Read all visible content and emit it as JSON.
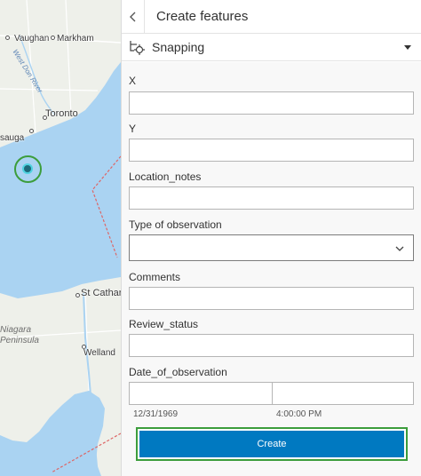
{
  "map": {
    "labels": {
      "vaughan": "Vaughan",
      "markham": "Markham",
      "west_don_river": "West Don River",
      "toronto": "Toronto",
      "mississauga": "sauga",
      "st_catharines": "St Cathari",
      "niagara_peninsula": "Niagara\nPeninsula",
      "welland": "Welland"
    },
    "icons": {
      "location_marker": "location-marker-icon"
    },
    "colors": {
      "water": "#aad3f2",
      "land": "#eef0ea",
      "marker_ring": "#3c9d3c",
      "marker_dot": "#1d6a7a"
    }
  },
  "panel": {
    "title": "Create features",
    "back_icon": "chevron-left-icon",
    "snapping": {
      "label": "Snapping",
      "icon": "snapping-icon",
      "caret_icon": "caret-down-icon"
    },
    "form": {
      "fields": {
        "x": {
          "label": "X",
          "value": ""
        },
        "y": {
          "label": "Y",
          "value": ""
        },
        "location_notes": {
          "label": "Location_notes",
          "value": ""
        },
        "type_of_observation": {
          "label": "Type of observation",
          "value": ""
        },
        "comments": {
          "label": "Comments",
          "value": ""
        },
        "review_status": {
          "label": "Review_status",
          "value": ""
        },
        "date_of_observation": {
          "label": "Date_of_observation",
          "date_value": "",
          "time_value": "",
          "date_hint": "12/31/1969",
          "time_hint": "4:00:00 PM"
        }
      },
      "create_label": "Create"
    },
    "colors": {
      "primary": "#0079c1",
      "highlight": "#3c9d3c"
    }
  }
}
